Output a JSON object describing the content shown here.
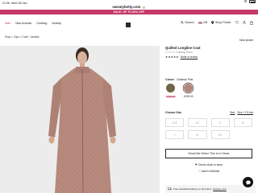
{
  "status_bar": {
    "time": "21:08",
    "date": "Wed 28 Dec"
  },
  "browser": {
    "url": "sweatybetty.com"
  },
  "promo": {
    "text": "SALE: UP TO 60% OFF"
  },
  "nav": {
    "links": [
      "Sale",
      "New Arrivals",
      "Clothing",
      "Activity"
    ],
    "search_label": "Search",
    "gb_label": "GB",
    "store_finder_label": "Shop Finder"
  },
  "breadcrumbs": [
    "Shop",
    "Tops",
    "Coat + Jackets"
  ],
  "most_picked": "Most picked",
  "product": {
    "title": "Quilted Longline Coat",
    "status_prefix": "£199.00",
    "status": "Coming Soon",
    "stars": "★★★★★",
    "reviews_label": "Write a review"
  },
  "color": {
    "label": "Colour",
    "selected": "Chateau Pink",
    "options": [
      {
        "name": "Olive",
        "hex": "#6e6547",
        "price": "£249.00"
      },
      {
        "name": "Chateau Pink",
        "hex": "#b3867a",
        "price": "£199.00"
      }
    ]
  },
  "size": {
    "label": "Choose Size",
    "guide_link": "Size",
    "fit_link": "Size + Fit Info",
    "options": [
      "XXS",
      "XS",
      "S",
      "M",
      "L",
      "XL",
      "XXL"
    ]
  },
  "actions": {
    "notify": "Email Me When This Is In Stock",
    "check_stock": "Check stock in store",
    "wishlist": "Add to Wishlist"
  },
  "delivery": {
    "text": "Free standard delivery on all orders",
    "link": "Delivery info"
  }
}
